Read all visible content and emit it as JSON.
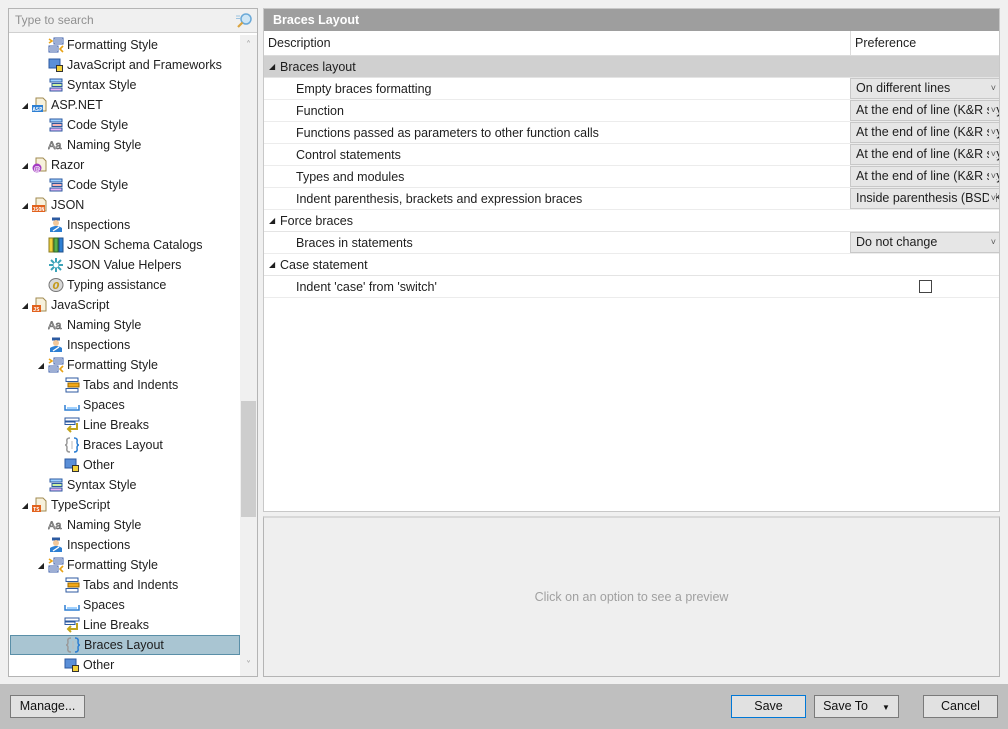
{
  "search": {
    "placeholder": "Type to search"
  },
  "tree": {
    "items": [
      {
        "label": "Formatting Style",
        "icon": "formatting-style-icon",
        "level": 2,
        "expander": ""
      },
      {
        "label": "JavaScript and Frameworks",
        "icon": "frameworks-icon",
        "level": 2,
        "expander": ""
      },
      {
        "label": "Syntax Style",
        "icon": "syntax-style-icon",
        "level": 2,
        "expander": ""
      },
      {
        "label": "ASP.NET",
        "icon": "aspnet-file-icon",
        "level": 1,
        "expander": "expanded"
      },
      {
        "label": "Code Style",
        "icon": "code-style-icon",
        "level": 2,
        "expander": ""
      },
      {
        "label": "Naming Style",
        "icon": "naming-style-icon",
        "level": 2,
        "expander": ""
      },
      {
        "label": "Razor",
        "icon": "razor-file-icon",
        "level": 1,
        "expander": "expanded"
      },
      {
        "label": "Code Style",
        "icon": "code-style-icon",
        "level": 2,
        "expander": ""
      },
      {
        "label": "JSON",
        "icon": "json-file-icon",
        "level": 1,
        "expander": "expanded"
      },
      {
        "label": "Inspections",
        "icon": "inspections-icon",
        "level": 2,
        "expander": ""
      },
      {
        "label": "JSON Schema Catalogs",
        "icon": "schema-catalogs-icon",
        "level": 2,
        "expander": ""
      },
      {
        "label": "JSON Value Helpers",
        "icon": "value-helpers-icon",
        "level": 2,
        "expander": ""
      },
      {
        "label": "Typing assistance",
        "icon": "typing-assistance-icon",
        "level": 2,
        "expander": ""
      },
      {
        "label": "JavaScript",
        "icon": "js-file-icon",
        "level": 1,
        "expander": "expanded"
      },
      {
        "label": "Naming Style",
        "icon": "naming-style-icon",
        "level": 2,
        "expander": ""
      },
      {
        "label": "Inspections",
        "icon": "inspections-icon",
        "level": 2,
        "expander": ""
      },
      {
        "label": "Formatting Style",
        "icon": "formatting-style-icon",
        "level": 2,
        "expander": "expanded"
      },
      {
        "label": "Tabs and Indents",
        "icon": "tabs-indents-icon",
        "level": 3,
        "expander": ""
      },
      {
        "label": "Spaces",
        "icon": "spaces-icon",
        "level": 3,
        "expander": ""
      },
      {
        "label": "Line Breaks",
        "icon": "line-breaks-icon",
        "level": 3,
        "expander": ""
      },
      {
        "label": "Braces Layout",
        "icon": "braces-layout-icon",
        "level": 3,
        "expander": ""
      },
      {
        "label": "Other",
        "icon": "other-icon",
        "level": 3,
        "expander": ""
      },
      {
        "label": "Syntax Style",
        "icon": "syntax-style-icon",
        "level": 2,
        "expander": ""
      },
      {
        "label": "TypeScript",
        "icon": "ts-file-icon",
        "level": 1,
        "expander": "expanded"
      },
      {
        "label": "Naming Style",
        "icon": "naming-style-icon",
        "level": 2,
        "expander": ""
      },
      {
        "label": "Inspections",
        "icon": "inspections-icon",
        "level": 2,
        "expander": ""
      },
      {
        "label": "Formatting Style",
        "icon": "formatting-style-icon",
        "level": 2,
        "expander": "expanded"
      },
      {
        "label": "Tabs and Indents",
        "icon": "tabs-indents-icon",
        "level": 3,
        "expander": ""
      },
      {
        "label": "Spaces",
        "icon": "spaces-icon",
        "level": 3,
        "expander": ""
      },
      {
        "label": "Line Breaks",
        "icon": "line-breaks-icon",
        "level": 3,
        "expander": ""
      },
      {
        "label": "Braces Layout",
        "icon": "braces-layout-icon",
        "level": 3,
        "expander": "",
        "selected": true
      },
      {
        "label": "Other",
        "icon": "other-icon",
        "level": 3,
        "expander": ""
      }
    ]
  },
  "panel": {
    "title": "Braces Layout",
    "columns": {
      "description": "Description",
      "preference": "Preference"
    },
    "rows": [
      {
        "type": "group",
        "label": "Braces layout",
        "shaded": true
      },
      {
        "type": "option",
        "label": "Empty braces formatting",
        "control": "select",
        "value": "On different lines"
      },
      {
        "type": "option",
        "label": "Function",
        "control": "select",
        "value": "At the end of line (K&R style)"
      },
      {
        "type": "option",
        "label": "Functions passed as parameters to other function calls",
        "control": "select",
        "value": "At the end of line (K&R style)"
      },
      {
        "type": "option",
        "label": "Control statements",
        "control": "select",
        "value": "At the end of line (K&R style)"
      },
      {
        "type": "option",
        "label": "Types and modules",
        "control": "select",
        "value": "At the end of line (K&R style)"
      },
      {
        "type": "option",
        "label": "Indent parenthesis, brackets and expression braces",
        "control": "select",
        "value": "Inside parenthesis (BSD/K&R style)"
      },
      {
        "type": "group",
        "label": "Force braces",
        "shaded": false
      },
      {
        "type": "option",
        "label": "Braces in statements",
        "control": "select",
        "value": "Do not change"
      },
      {
        "type": "group",
        "label": "Case statement",
        "shaded": false
      },
      {
        "type": "option",
        "label": "Indent 'case' from 'switch'",
        "control": "checkbox",
        "checked": false
      }
    ],
    "preview_hint": "Click on an option to see a preview"
  },
  "footer": {
    "manage_label": "Manage...",
    "save_label": "Save",
    "save_to_label": "Save To",
    "cancel_label": "Cancel"
  }
}
